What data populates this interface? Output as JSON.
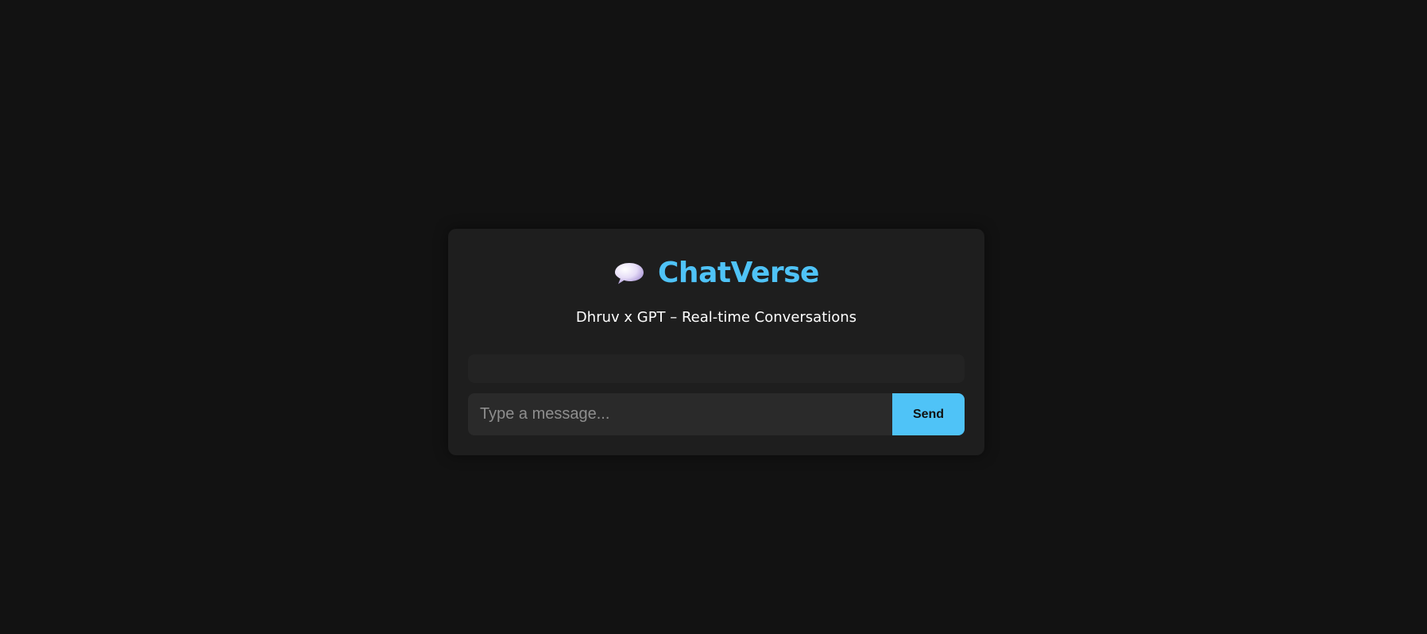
{
  "app": {
    "icon": "speech-bubble-icon",
    "title": "ChatVerse",
    "subtitle": "Dhruv x GPT – Real-time Conversations"
  },
  "chat": {
    "messages": []
  },
  "composer": {
    "placeholder": "Type a message...",
    "value": "",
    "send_label": "Send"
  },
  "colors": {
    "background": "#121212",
    "card": "#1e1e1e",
    "accent": "#4fc3f7",
    "input_background": "#2a2a2a",
    "text": "#ffffff"
  }
}
